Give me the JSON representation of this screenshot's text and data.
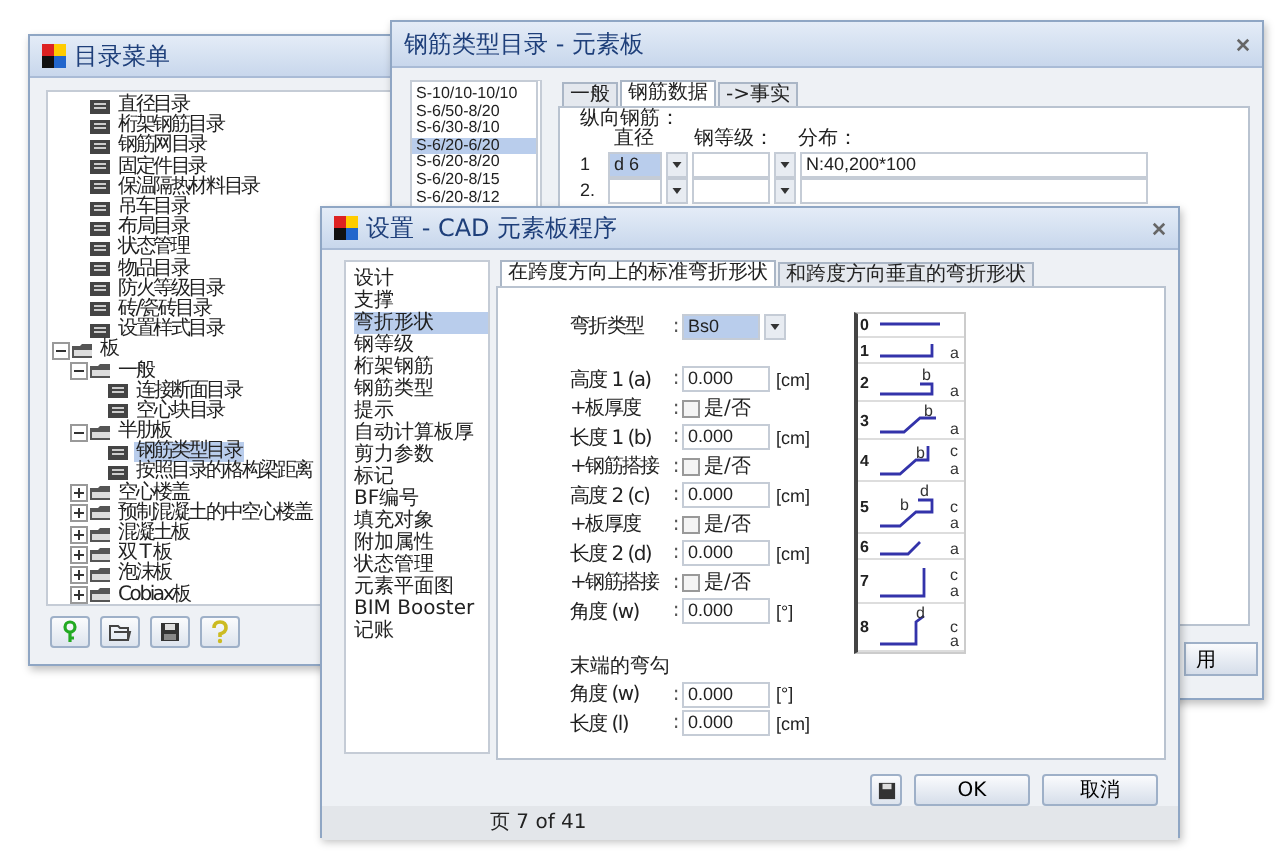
{
  "catalog_window": {
    "title": "目录菜单",
    "tree": {
      "cut_branch": [
        {
          "label": "直径目录",
          "selected": false
        },
        {
          "label": "桁架钢筋目录",
          "selected": false
        },
        {
          "label": "钢筋网目录",
          "selected": false
        },
        {
          "label": "固定件目录",
          "selected": false
        },
        {
          "label": "保温隔热材料目录",
          "selected": false
        },
        {
          "label": "吊车目录",
          "selected": false
        },
        {
          "label": "布局目录",
          "selected": false
        },
        {
          "label": "状态管理",
          "selected": false
        },
        {
          "label": "物品目录",
          "selected": false
        },
        {
          "label": "防火等级目录",
          "selected": false
        },
        {
          "label": "砖/瓷砖目录",
          "selected": false
        },
        {
          "label": "设置样式目录",
          "selected": false
        }
      ],
      "items": [
        {
          "label": "板",
          "expanded": true,
          "selected": false,
          "children": [
            {
              "label": "一般",
              "expanded": true,
              "selected": false,
              "children": [
                {
                  "label": "连接断面目录",
                  "selected": false
                },
                {
                  "label": "空心块目录",
                  "selected": false
                }
              ]
            },
            {
              "label": "半肋板",
              "expanded": true,
              "selected": false,
              "children": [
                {
                  "label": "钢筋类型目录",
                  "selected": true
                },
                {
                  "label": "按照目录的格构梁距离",
                  "selected": false
                }
              ]
            },
            {
              "label": "空心楼盖",
              "expanded": false,
              "selected": false
            },
            {
              "label": "预制混凝土的中空心楼盖",
              "expanded": false,
              "selected": false
            },
            {
              "label": "混凝土板",
              "expanded": false,
              "selected": false
            },
            {
              "label": "双 T 板",
              "expanded": false,
              "selected": false
            },
            {
              "label": "泡沫板",
              "expanded": false,
              "selected": false
            },
            {
              "label": "Cobiax板",
              "expanded": false,
              "selected": false
            }
          ]
        }
      ]
    }
  },
  "rebar_window": {
    "title": "钢筋类型目录 - 元素板",
    "list": [
      {
        "label": "S-10/10-10/10",
        "selected": false
      },
      {
        "label": "S-6/50-8/20",
        "selected": false
      },
      {
        "label": "S-6/30-8/10",
        "selected": false
      },
      {
        "label": "S-6/20-6/20",
        "selected": true
      },
      {
        "label": "S-6/20-8/20",
        "selected": false
      },
      {
        "label": "S-6/20-8/15",
        "selected": false
      },
      {
        "label": "S-6/20-8/12",
        "selected": false
      }
    ],
    "tabs": [
      {
        "label": "一般",
        "selected": false
      },
      {
        "label": "钢筋数据",
        "selected": true
      },
      {
        "label": "->事实",
        "selected": false
      }
    ],
    "group_label": "纵向钢筋：",
    "columns": [
      "直径",
      "钢等级：",
      "分布："
    ],
    "rows": [
      {
        "index": "1",
        "diameter": "d 6",
        "distribution": "N:40,200*100"
      },
      {
        "index": "2."
      }
    ],
    "partial_button": "用"
  },
  "settings_window": {
    "title": "设置 - CAD 元素板程序",
    "nav": [
      {
        "label": "设计",
        "selected": false
      },
      {
        "label": "支撑",
        "selected": false
      },
      {
        "label": "弯折形状",
        "selected": true
      },
      {
        "label": "钢等级",
        "selected": false
      },
      {
        "label": "桁架钢筋",
        "selected": false
      },
      {
        "label": "钢筋类型",
        "selected": false
      },
      {
        "label": "提示",
        "selected": false
      },
      {
        "label": "自动计算板厚",
        "selected": false
      },
      {
        "label": "剪力参数",
        "selected": false
      },
      {
        "label": "标记",
        "selected": false
      },
      {
        "label": "BF编号",
        "selected": false
      },
      {
        "label": "填充对象",
        "selected": false
      },
      {
        "label": "附加属性",
        "selected": false
      },
      {
        "label": "状态管理",
        "selected": false
      },
      {
        "label": "元素平面图",
        "selected": false
      },
      {
        "label": "BIM Booster",
        "selected": false
      },
      {
        "label": "记账",
        "selected": false
      }
    ],
    "tabs": [
      {
        "label": "在跨度方向上的标准弯折形状",
        "selected": true
      },
      {
        "label": "和跨度方向垂直的弯折形状",
        "selected": false
      }
    ],
    "bend_type": {
      "label": "弯折类型",
      "sep": ":",
      "value": "Bs0"
    },
    "fields": [
      {
        "kind": "number",
        "label": "高度 1 (a)",
        "sep": ":",
        "value": "0.000",
        "unit": "[cm]"
      },
      {
        "kind": "checkbox",
        "label": "+板厚度",
        "sep": ":",
        "option": "是/否",
        "checked": false
      },
      {
        "kind": "number",
        "label": "长度 1 (b)",
        "sep": ":",
        "value": "0.000",
        "unit": "[cm]"
      },
      {
        "kind": "checkbox",
        "label": "+钢筋搭接",
        "sep": ":",
        "option": "是/否",
        "checked": false
      },
      {
        "kind": "number",
        "label": "高度 2 (c)",
        "sep": ":",
        "value": "0.000",
        "unit": "[cm]"
      },
      {
        "kind": "checkbox",
        "label": "+板厚度",
        "sep": ":",
        "option": "是/否",
        "checked": false
      },
      {
        "kind": "number",
        "label": "长度 2 (d)",
        "sep": ":",
        "value": "0.000",
        "unit": "[cm]"
      },
      {
        "kind": "checkbox",
        "label": "+钢筋搭接",
        "sep": ":",
        "option": "是/否",
        "checked": false
      },
      {
        "kind": "number",
        "label": "角度 (w)",
        "sep": ":",
        "value": "0.000",
        "unit": "[°]"
      }
    ],
    "end_hook": {
      "title": "末端的弯勾",
      "fields": [
        {
          "kind": "number",
          "label": "角度 (w)",
          "sep": ":",
          "value": "0.000",
          "unit": "[°]"
        },
        {
          "kind": "number",
          "label": "长度 (l)",
          "sep": ":",
          "value": "0.000",
          "unit": "[cm]"
        }
      ]
    },
    "shapes": [
      {
        "number": "0"
      },
      {
        "number": "1",
        "labels": [
          "a"
        ]
      },
      {
        "number": "2",
        "labels": [
          "b",
          "a"
        ]
      },
      {
        "number": "3",
        "labels": [
          "b",
          "a"
        ]
      },
      {
        "number": "4",
        "labels": [
          "b",
          "c",
          "a"
        ]
      },
      {
        "number": "5",
        "labels": [
          "d",
          "b",
          "c",
          "a"
        ]
      },
      {
        "number": "6",
        "labels": [
          "a"
        ]
      },
      {
        "number": "7",
        "labels": [
          "c",
          "a"
        ]
      },
      {
        "number": "8",
        "labels": [
          "d",
          "c",
          "a"
        ]
      }
    ],
    "ok": "OK",
    "cancel": "取消",
    "status": "页 7 of 41"
  }
}
